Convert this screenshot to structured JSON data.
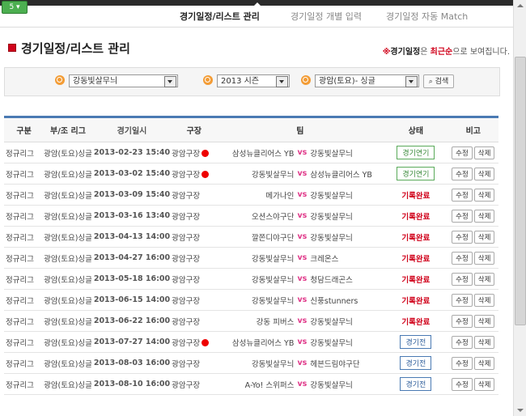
{
  "badge": "5",
  "tabs": [
    "경기일정/리스트 관리",
    "경기일정 개별 입력",
    "경기일정 자동 Match"
  ],
  "page": {
    "title": "경기일정/리스트 관리",
    "notice": {
      "x": "※",
      "bold": "경기일정",
      "mid": "은 ",
      "red": "최근순",
      "tail": "으로 보여집니다."
    }
  },
  "filter": {
    "team": "강동빛살무늬",
    "season": "2013 시즌",
    "league": "광암(토요)- 싱글",
    "search_label": "검색"
  },
  "table": {
    "headers": [
      "구분",
      "부/조 리그",
      "경기일시",
      "구장",
      "팀",
      "상태",
      "비고"
    ],
    "edit_label": "수정",
    "delete_label": "삭제",
    "rows": [
      {
        "category": "정규리그",
        "league": "광암(토요)싱글",
        "datetime": "2013-02-23  15:40",
        "venue": "광암구장",
        "live": true,
        "home": "삼성뉴클리어스 YB",
        "vs": "vs",
        "away": "강동빛살무늬",
        "status": "경기연기"
      },
      {
        "category": "정규리그",
        "league": "광암(토요)싱글",
        "datetime": "2013-03-02  15:40",
        "venue": "광암구장",
        "live": true,
        "home": "강동빛살무늬",
        "vs": "vs",
        "away": "삼성뉴클리어스 YB",
        "status": "경기연기"
      },
      {
        "category": "정규리그",
        "league": "광암(토요)싱글",
        "datetime": "2013-03-09  15:40",
        "venue": "광암구장",
        "live": false,
        "home": "메가나인",
        "vs": "vs",
        "away": "강동빛살무늬",
        "status": "기록완료"
      },
      {
        "category": "정규리그",
        "league": "광암(토요)싱글",
        "datetime": "2013-03-16  13:40",
        "venue": "광암구장",
        "live": false,
        "home": "오션스야구단",
        "vs": "vs",
        "away": "강동빛살무늬",
        "status": "기록완료"
      },
      {
        "category": "정규리그",
        "league": "광암(토요)싱글",
        "datetime": "2013-04-13  14:00",
        "venue": "광암구장",
        "live": false,
        "home": "깔쫀디야구단",
        "vs": "vs",
        "away": "강동빛살무늬",
        "status": "기록완료"
      },
      {
        "category": "정규리그",
        "league": "광암(토요)싱글",
        "datetime": "2013-04-27  16:00",
        "venue": "광암구장",
        "live": false,
        "home": "강동빛살무늬",
        "vs": "vs",
        "away": "크레온스",
        "status": "기록완료"
      },
      {
        "category": "정규리그",
        "league": "광암(토요)싱글",
        "datetime": "2013-05-18  16:00",
        "venue": "광암구장",
        "live": false,
        "home": "강동빛살무늬",
        "vs": "vs",
        "away": "청담드래곤스",
        "status": "기록완료"
      },
      {
        "category": "정규리그",
        "league": "광암(토요)싱글",
        "datetime": "2013-06-15  14:00",
        "venue": "광암구장",
        "live": false,
        "home": "강동빛살무늬",
        "vs": "vs",
        "away": "신풍stunners",
        "status": "기록완료"
      },
      {
        "category": "정규리그",
        "league": "광암(토요)싱글",
        "datetime": "2013-06-22  16:00",
        "venue": "광암구장",
        "live": false,
        "home": "강동 피버스",
        "vs": "vs",
        "away": "강동빛살무늬",
        "status": "기록완료"
      },
      {
        "category": "정규리그",
        "league": "광암(토요)싱글",
        "datetime": "2013-07-27  14:00",
        "venue": "광암구장",
        "live": true,
        "home": "삼성뉴클리어스 YB",
        "vs": "vs",
        "away": "강동빛살무늬",
        "status": "경기전"
      },
      {
        "category": "정규리그",
        "league": "광암(토요)싱글",
        "datetime": "2013-08-03  16:00",
        "venue": "광암구장",
        "live": false,
        "home": "강동빛살무늬",
        "vs": "vs",
        "away": "헤븐드림야구단",
        "status": "경기전"
      },
      {
        "category": "정규리그",
        "league": "광암(토요)싱글",
        "datetime": "2013-08-10  16:00",
        "venue": "광암구장",
        "live": false,
        "home": "A-Yo! 스위퍼스",
        "vs": "vs",
        "away": "강동빛살무늬",
        "status": "경기전"
      }
    ]
  }
}
